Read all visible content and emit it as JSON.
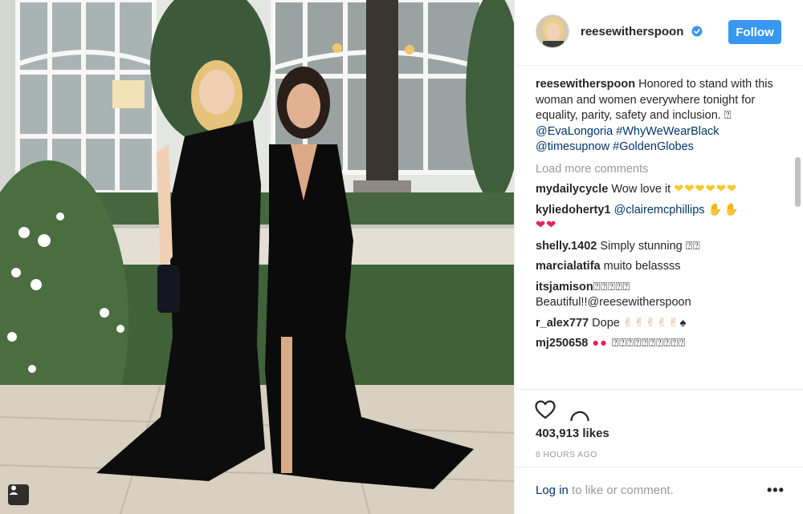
{
  "post": {
    "username": "reesewitherspoon",
    "follow_label": "Follow",
    "caption": {
      "user": "reesewitherspoon",
      "text": " Honored to stand with this woman and women everywhere tonight for equality, parity, safety and inclusion. ",
      "tofu": "⍰",
      "mention": "@EvaLongoria",
      "hashtag1": "#WhyWeWearBlack",
      "mention2": "@timesupnow",
      "hashtag2": "#GoldenGlobes"
    },
    "load_more_label": "Load more comments",
    "comments": [
      {
        "user": "mydailycycle",
        "text": " Wow love it ",
        "emoji": "❤❤❤❤❤❤"
      },
      {
        "user": "kyliedoherty1",
        "mention": " @clairemcphillips ",
        "emoji": "✋✋",
        "emoji2": "❤❤"
      },
      {
        "user": "shelly.1402",
        "text": " Simply stunning ",
        "tofu": "⍰⍰"
      },
      {
        "user": "marcialatifa",
        "text": " muito belassss"
      },
      {
        "user": "itsjamison",
        "tofu": " ⍰⍰⍰⍰⍰",
        "text2": "Beautiful!!@reesewitherspoon"
      },
      {
        "user": "r_alex777",
        "text": " Dope ",
        "emoji": "✌✌✌✌✌",
        "emoji2": "♠"
      },
      {
        "user": "mj250658",
        "emoji": " ●● ",
        "tofu": "⍰⍰⍰⍰⍰⍰⍰⍰⍰⍰"
      }
    ],
    "likes": "403,913 likes",
    "time": "8 HOURS AGO",
    "login_link": "Log in",
    "login_rest": " to like or comment.",
    "more_label": "•••"
  },
  "colors": {
    "follow_bg": "#3897f0",
    "link": "#003569",
    "muted": "#999999",
    "verified": "#3897f0"
  },
  "icons": [
    "user-tag-icon",
    "verified-badge-icon",
    "heart-icon",
    "comment-icon",
    "more-icon"
  ]
}
